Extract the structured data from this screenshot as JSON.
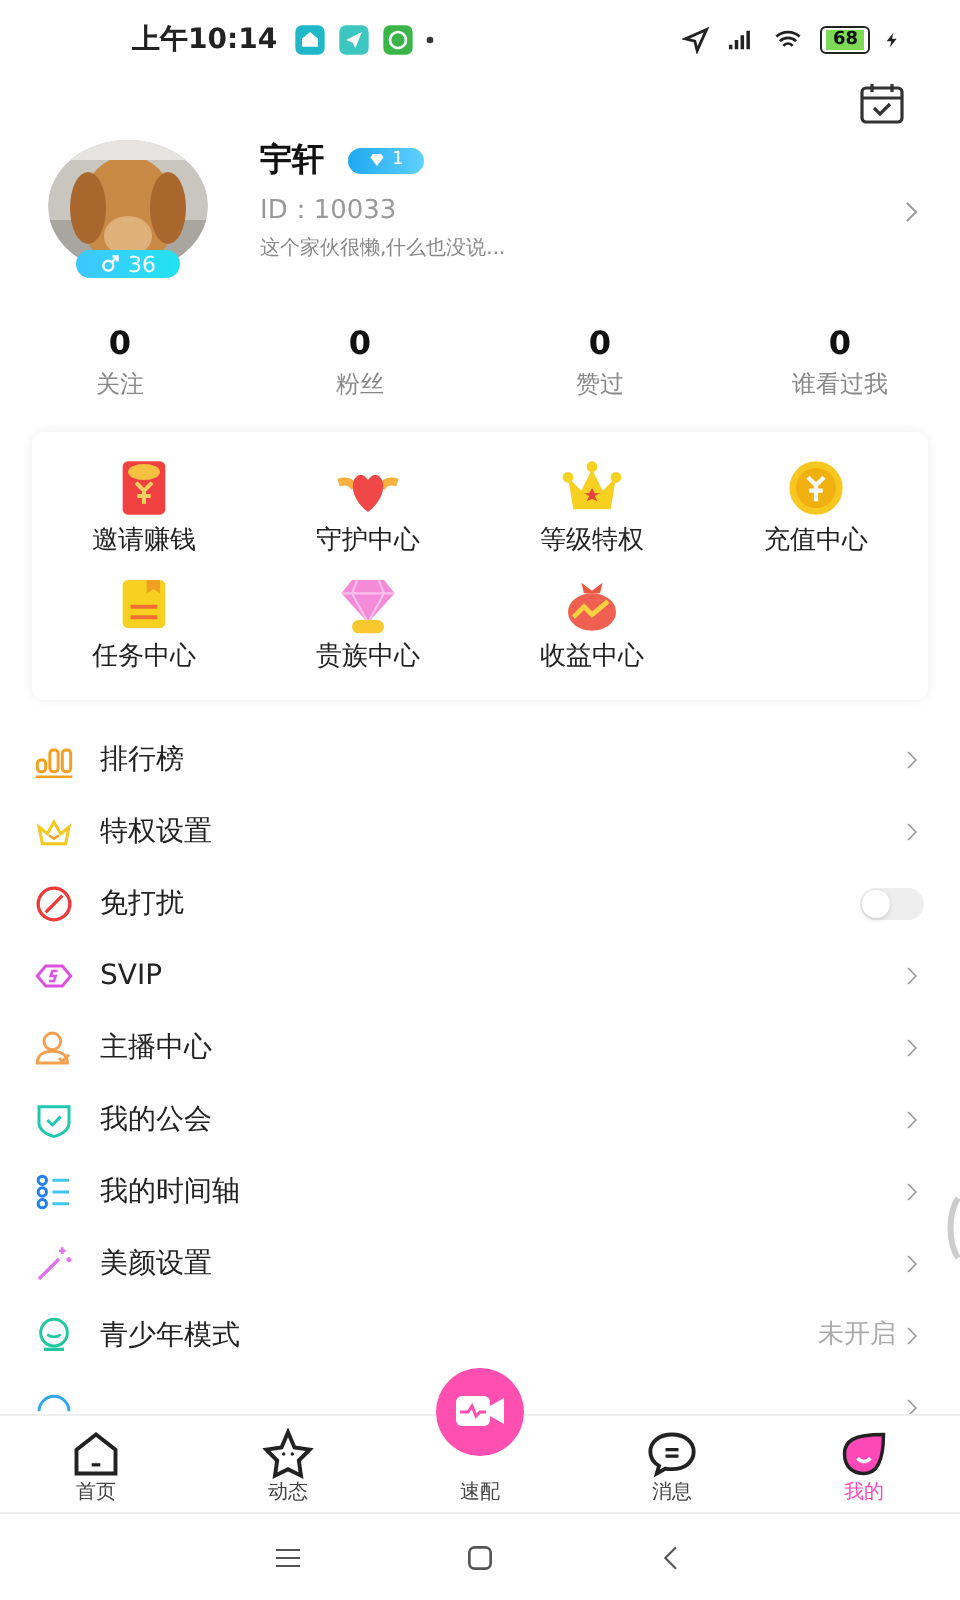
{
  "status_bar": {
    "time": "上午10:14",
    "battery": "68"
  },
  "profile": {
    "name": "宇轩",
    "level_badge": "1",
    "gender_age": "36",
    "id": "ID：10033",
    "bio": "这个家伙很懒,什么也没说..."
  },
  "stats": [
    {
      "value": "0",
      "label": "关注"
    },
    {
      "value": "0",
      "label": "粉丝"
    },
    {
      "value": "0",
      "label": "赞过"
    },
    {
      "value": "0",
      "label": "谁看过我"
    }
  ],
  "features": [
    {
      "kind": "redpacket",
      "label": "邀请赚钱"
    },
    {
      "kind": "heart",
      "label": "守护中心"
    },
    {
      "kind": "crown",
      "label": "等级特权"
    },
    {
      "kind": "coin",
      "label": "充值中心"
    },
    {
      "kind": "task",
      "label": "任务中心"
    },
    {
      "kind": "diamond",
      "label": "贵族中心"
    },
    {
      "kind": "bag",
      "label": "收益中心"
    }
  ],
  "menu": [
    {
      "kind": "link",
      "label": "排行榜"
    },
    {
      "kind": "link",
      "label": "特权设置"
    },
    {
      "kind": "toggle",
      "label": "免打扰",
      "on": false
    },
    {
      "kind": "link",
      "label": "SVIP"
    },
    {
      "kind": "link",
      "label": "主播中心"
    },
    {
      "kind": "link",
      "label": "我的公会"
    },
    {
      "kind": "link",
      "label": "我的时间轴"
    },
    {
      "kind": "link",
      "label": "美颜设置"
    },
    {
      "kind": "link",
      "label": "青少年模式",
      "value": "未开启"
    },
    {
      "kind": "link"
    }
  ],
  "bottom_nav": [
    {
      "label": "首页",
      "selected": false
    },
    {
      "label": "动态",
      "selected": false
    },
    {
      "label": "速配",
      "selected": false
    },
    {
      "label": "消息",
      "selected": false
    },
    {
      "label": "我的",
      "selected": true
    }
  ]
}
